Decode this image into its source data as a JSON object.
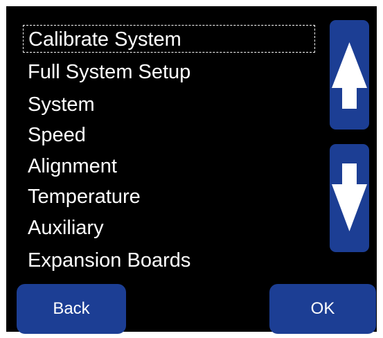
{
  "menu": {
    "items": [
      {
        "label": "Calibrate System",
        "selected": true
      },
      {
        "label": "Full System Setup",
        "selected": false
      },
      {
        "label": "System",
        "selected": false
      },
      {
        "label": "Speed",
        "selected": false
      },
      {
        "label": "Alignment",
        "selected": false
      },
      {
        "label": "Temperature",
        "selected": false
      },
      {
        "label": "Auxiliary",
        "selected": false
      },
      {
        "label": "Expansion Boards",
        "selected": false
      }
    ]
  },
  "scroll": {
    "up_icon": "arrow-up-icon",
    "down_icon": "arrow-down-icon"
  },
  "buttons": {
    "back_label": "Back",
    "ok_label": "OK"
  },
  "colors": {
    "background": "#000000",
    "button": "#1c3e94",
    "text": "#ffffff"
  }
}
